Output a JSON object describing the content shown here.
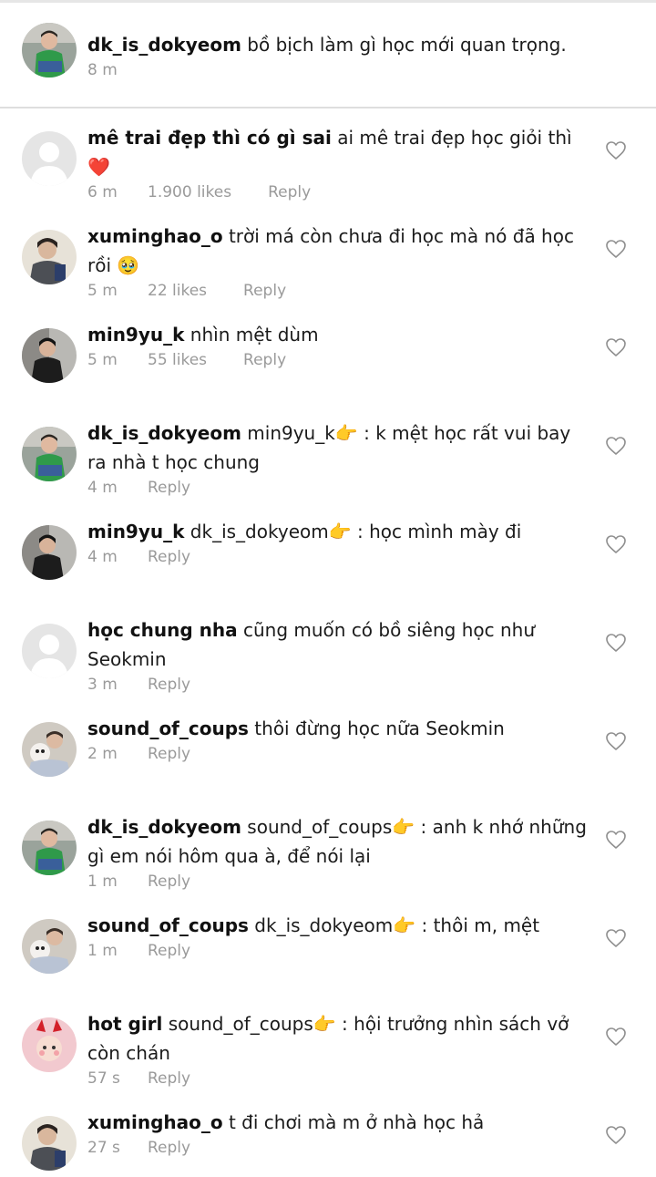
{
  "caption": {
    "username": "dk_is_dokyeom",
    "text": "bồ bịch làm gì học mới quan trọng.",
    "time": "8 m"
  },
  "ui": {
    "reply_label": "Reply",
    "point_emoji": "👉",
    "sep": ":"
  },
  "comments": [
    {
      "username": "mê trai đẹp thì có gì sai",
      "mention": "",
      "text": "ai mê trai đẹp học giỏi thì ❤️",
      "time": "6 m",
      "likes": "1.900 likes",
      "avatar": "default"
    },
    {
      "username": "xuminghao_o",
      "mention": "",
      "text": "trời má còn chưa đi học mà nó đã học rồi 🥹",
      "time": "5 m",
      "likes": "22 likes",
      "avatar": "xuminghao"
    },
    {
      "username": "min9yu_k",
      "mention": "",
      "text": "nhìn mệt dùm",
      "time": "5 m",
      "likes": "55 likes",
      "avatar": "mingyu"
    },
    {
      "username": "dk_is_dokyeom",
      "mention": "min9yu_k",
      "text": "k mệt học rất vui bay ra nhà t học chung",
      "time": "4 m",
      "likes": "",
      "avatar": "dokyeom"
    },
    {
      "username": "min9yu_k",
      "mention": "dk_is_dokyeom",
      "text": "học mình mày đi",
      "time": "4 m",
      "likes": "",
      "avatar": "mingyu"
    },
    {
      "username": "học chung nha",
      "mention": "",
      "text": "cũng muốn có bồ siêng học như Seokmin",
      "time": "3 m",
      "likes": "",
      "avatar": "default"
    },
    {
      "username": "sound_of_coups",
      "mention": "",
      "text": "thôi đừng học nữa Seokmin",
      "time": "2 m",
      "likes": "",
      "avatar": "coups"
    },
    {
      "username": "dk_is_dokyeom",
      "mention": "sound_of_coups",
      "text": "anh k nhớ những gì em nói hôm qua à,  để nói lại",
      "time": "1 m",
      "likes": "",
      "avatar": "dokyeom"
    },
    {
      "username": "sound_of_coups",
      "mention": "dk_is_dokyeom",
      "text": "thôi m, mệt",
      "time": "1 m",
      "likes": "",
      "avatar": "coups"
    },
    {
      "username": "hot girl",
      "mention": "sound_of_coups",
      "text": "hội trưởng nhìn sách vở còn chán",
      "time": "57 s",
      "likes": "",
      "avatar": "hotgirl"
    },
    {
      "username": "xuminghao_o",
      "mention": "",
      "text": "t đi chơi mà m ở nhà học hả",
      "time": "27 s",
      "likes": "",
      "avatar": "xuminghao"
    }
  ]
}
